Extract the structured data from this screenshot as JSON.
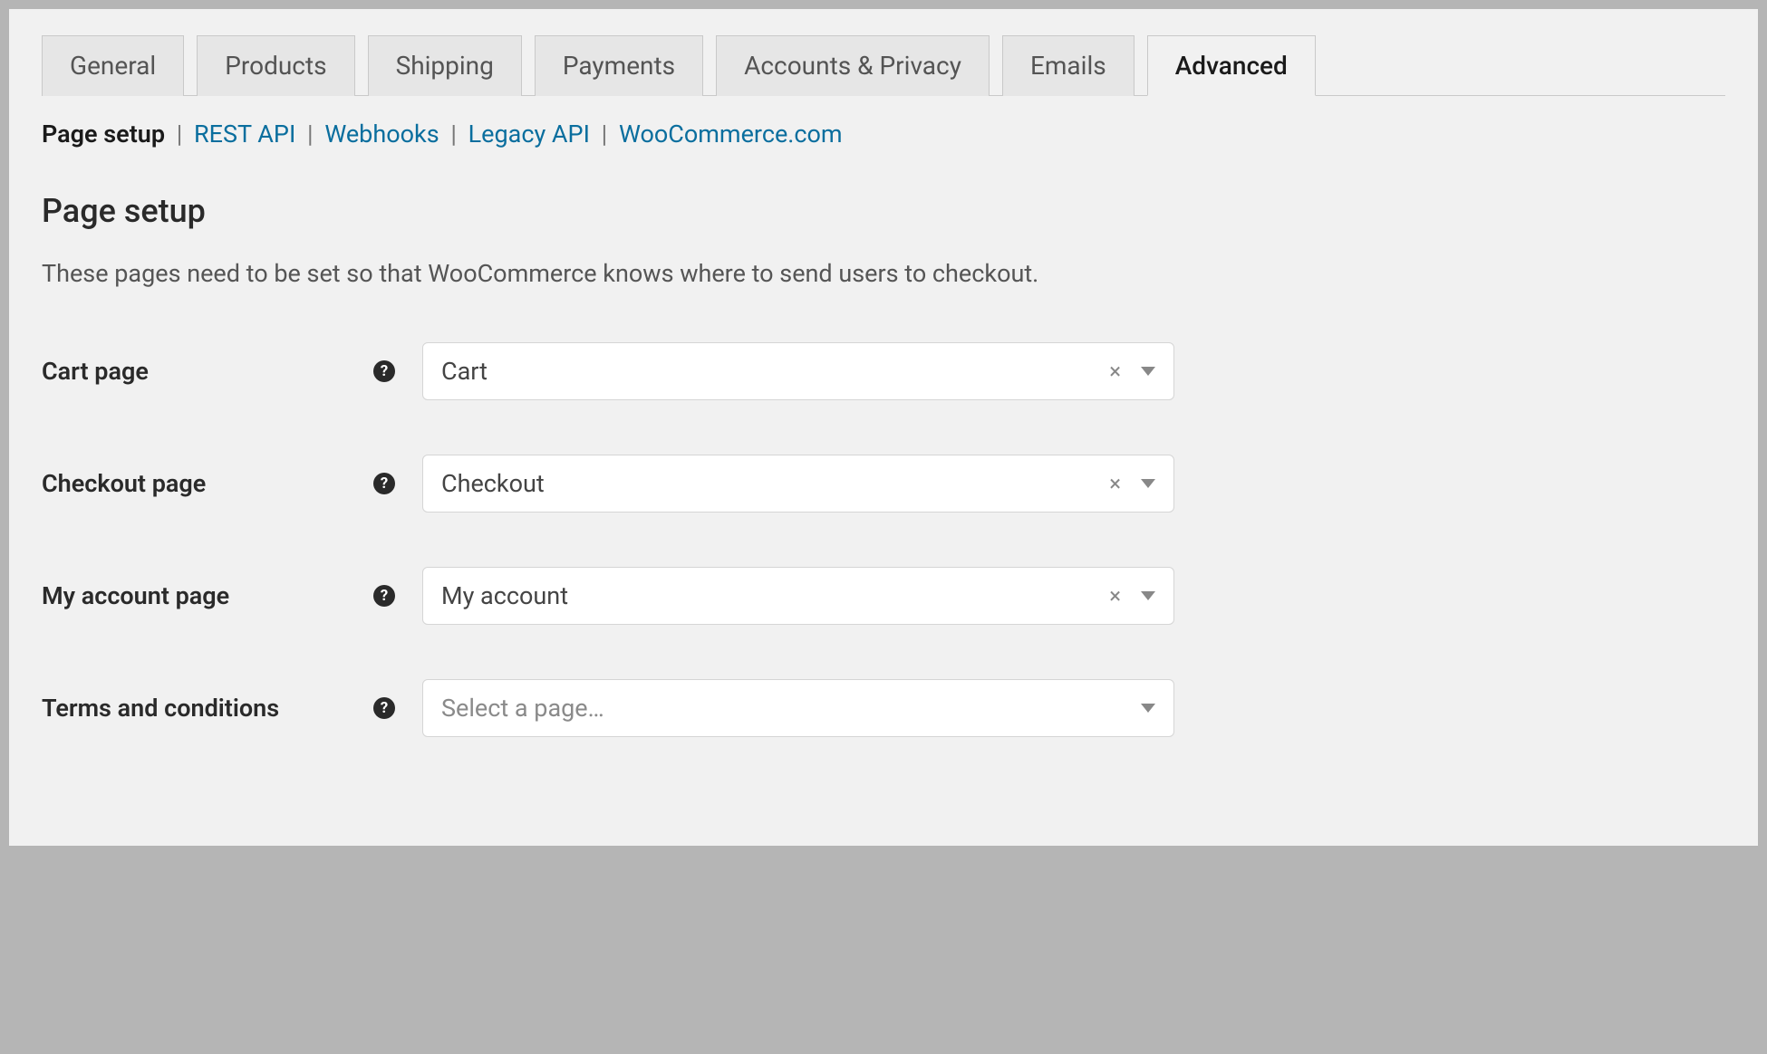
{
  "tabs": [
    {
      "label": "General",
      "active": false
    },
    {
      "label": "Products",
      "active": false
    },
    {
      "label": "Shipping",
      "active": false
    },
    {
      "label": "Payments",
      "active": false
    },
    {
      "label": "Accounts & Privacy",
      "active": false
    },
    {
      "label": "Emails",
      "active": false
    },
    {
      "label": "Advanced",
      "active": true
    }
  ],
  "subnav": {
    "current": "Page setup",
    "links": [
      "REST API",
      "Webhooks",
      "Legacy API",
      "WooCommerce.com"
    ]
  },
  "section": {
    "title": "Page setup",
    "description": "These pages need to be set so that WooCommerce knows where to send users to checkout."
  },
  "fields": {
    "cart": {
      "label": "Cart page",
      "value": "Cart",
      "clearable": true
    },
    "checkout": {
      "label": "Checkout page",
      "value": "Checkout",
      "clearable": true
    },
    "account": {
      "label": "My account page",
      "value": "My account",
      "clearable": true
    },
    "terms": {
      "label": "Terms and conditions",
      "placeholder": "Select a page…",
      "clearable": false
    }
  },
  "icons": {
    "help": "?",
    "clear": "×"
  }
}
